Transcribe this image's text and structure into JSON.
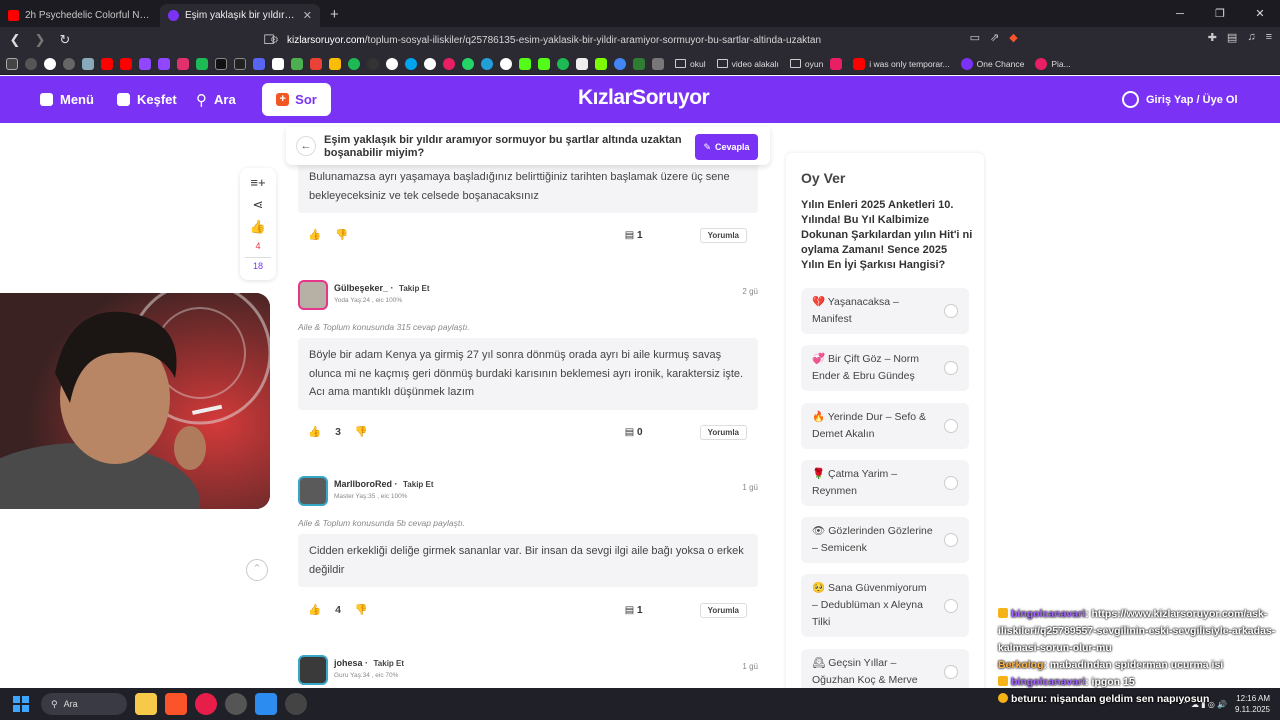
{
  "browser": {
    "tabs": [
      {
        "title": "2h Psychedelic Colorful Neon Backgr",
        "active": false,
        "favicon_color": "#ff0000"
      },
      {
        "title": "Eşim yaklaşık bir yıldır aramıyor...",
        "active": true,
        "favicon_color": "#7a33f5"
      }
    ],
    "new_tab": "+",
    "address_prefix": "kizlarsoruyor.com",
    "address_path": "/toplum-sosyal-iliskiler/q25786135-esim-yaklasik-bir-yildir-aramiyor-sormuyor-bu-sartlar-altinda-uzaktan",
    "bookmarks_folders": [
      "okul",
      "video alakalı",
      "oyun"
    ],
    "bookmarks_items": [
      "i was only temporar...",
      "One Chance",
      "Pia..."
    ]
  },
  "header": {
    "menu_label": "Menü",
    "kesfet_label": "Keşfet",
    "ara_label": "Ara",
    "sor_label": "Sor",
    "logo_text": "KızlarSoruyor",
    "login_label": "Giriş Yap / Üye Ol"
  },
  "question_bar": {
    "title": "Eşim yaklaşık bir yıldır aramıyor sormuyor bu şartlar altında uzaktan boşanabilir miyim?",
    "answer_button": "Cevapla"
  },
  "side_actions": {
    "likes": "4",
    "comments": "18"
  },
  "answers": [
    {
      "text": "Bulunamazsa ayrı yaşamaya başladığınız belirttiğiniz tarihten başlamak üzere üç sene bekleyeceksiniz ve tek celsede boşanacaksınız",
      "likes": "",
      "comments": "1",
      "reply_label": "Yorumla"
    },
    {
      "username": "Gülbeşeker_",
      "follow": "Takip Et",
      "meta": "Yoda Yaş:24 , eic 100%",
      "time": "2 gü",
      "topic": "Aile & Toplum konusunda 315 cevap paylaştı.",
      "text": "Böyle bir adam Kenya ya girmiş 27 yıl sonra dönmüş orada ayrı bi aile kurmuş savaş olunca mi ne kaçmış geri dönmüş burdaki karısının beklemesi ayrı ironik, karaktersiz işte. Acı ama mantıklı düşünmek lazım",
      "likes": "3",
      "comments": "0",
      "reply_label": "Yorumla"
    },
    {
      "username": "MarllboroRed",
      "follow": "Takip Et",
      "meta": "Master Yaş:35 , eic 100%",
      "time": "1 gü",
      "topic": "Aile & Toplum konusunda 5b cevap paylaştı.",
      "text": "Cidden erkekliği deliğe girmek sananlar var. Bir insan da sevgi ilgi aile bağı yoksa o erkek değildir",
      "likes": "4",
      "comments": "1",
      "reply_label": "Yorumla"
    },
    {
      "username": "johesa",
      "follow": "Takip Et",
      "meta": "Guru Yaş:34 , eic 70%",
      "time": "1 gü"
    }
  ],
  "poll": {
    "heading": "Oy Ver",
    "question": "Yılın Enleri 2025 Anketleri 10. Yılında! Bu Yıl Kalbimize Dokunan Şarkılardan yılın Hit'i ni oylama Zamanı! Sence 2025 Yılın En İyi Şarkısı Hangisi?",
    "options": [
      "💔 Yaşanacaksa – Manifest",
      "💞 Bir Çift Göz – Norm Ender & Ebru Gündeş",
      "🔥 Yerinde Dur – Sefo & Demet Akalın",
      "🌹 Çatma Yarim – Reynmen",
      "👁 Gözlerinden Gözlerine – Semicenk",
      "🥺 Sana Güvenmiyorum – Dedublüman x Aleyna Tilki",
      "🕰 Geçsin Yıllar – Oğuzhan Koç & Merve"
    ]
  },
  "chat": [
    {
      "user": "bingolcanavari",
      "message": ": https://www.kizlarsoruyor.com/ask-iliskileri/q25789557-sevgilinin-eski-sevgilisiyle-arkadas-kalmasi-sorun-olur-mu"
    },
    {
      "user": "Berkolog",
      "message": ": mabadindan spiderman ucurma isi"
    },
    {
      "user": "bingolcanavari",
      "message": ": ipgon 15"
    },
    {
      "user": "beturu",
      "message": ": nişandan geldim sen napıyosun"
    }
  ],
  "taskbar": {
    "search_label": "Ara",
    "time": "12:16 AM",
    "date": "9.11.2025"
  }
}
